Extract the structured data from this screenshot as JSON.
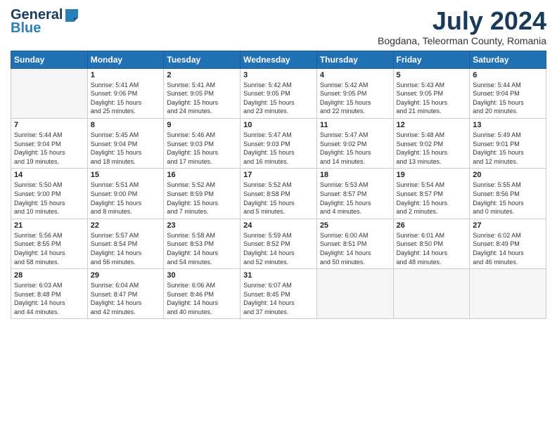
{
  "logo": {
    "line1": "General",
    "line2": "Blue"
  },
  "title": "July 2024",
  "location": "Bogdana, Teleorman County, Romania",
  "weekdays": [
    "Sunday",
    "Monday",
    "Tuesday",
    "Wednesday",
    "Thursday",
    "Friday",
    "Saturday"
  ],
  "weeks": [
    [
      {
        "day": "",
        "info": ""
      },
      {
        "day": "1",
        "info": "Sunrise: 5:41 AM\nSunset: 9:06 PM\nDaylight: 15 hours\nand 25 minutes."
      },
      {
        "day": "2",
        "info": "Sunrise: 5:41 AM\nSunset: 9:05 PM\nDaylight: 15 hours\nand 24 minutes."
      },
      {
        "day": "3",
        "info": "Sunrise: 5:42 AM\nSunset: 9:05 PM\nDaylight: 15 hours\nand 23 minutes."
      },
      {
        "day": "4",
        "info": "Sunrise: 5:42 AM\nSunset: 9:05 PM\nDaylight: 15 hours\nand 22 minutes."
      },
      {
        "day": "5",
        "info": "Sunrise: 5:43 AM\nSunset: 9:05 PM\nDaylight: 15 hours\nand 21 minutes."
      },
      {
        "day": "6",
        "info": "Sunrise: 5:44 AM\nSunset: 9:04 PM\nDaylight: 15 hours\nand 20 minutes."
      }
    ],
    [
      {
        "day": "7",
        "info": "Sunrise: 5:44 AM\nSunset: 9:04 PM\nDaylight: 15 hours\nand 19 minutes."
      },
      {
        "day": "8",
        "info": "Sunrise: 5:45 AM\nSunset: 9:04 PM\nDaylight: 15 hours\nand 18 minutes."
      },
      {
        "day": "9",
        "info": "Sunrise: 5:46 AM\nSunset: 9:03 PM\nDaylight: 15 hours\nand 17 minutes."
      },
      {
        "day": "10",
        "info": "Sunrise: 5:47 AM\nSunset: 9:03 PM\nDaylight: 15 hours\nand 16 minutes."
      },
      {
        "day": "11",
        "info": "Sunrise: 5:47 AM\nSunset: 9:02 PM\nDaylight: 15 hours\nand 14 minutes."
      },
      {
        "day": "12",
        "info": "Sunrise: 5:48 AM\nSunset: 9:02 PM\nDaylight: 15 hours\nand 13 minutes."
      },
      {
        "day": "13",
        "info": "Sunrise: 5:49 AM\nSunset: 9:01 PM\nDaylight: 15 hours\nand 12 minutes."
      }
    ],
    [
      {
        "day": "14",
        "info": "Sunrise: 5:50 AM\nSunset: 9:00 PM\nDaylight: 15 hours\nand 10 minutes."
      },
      {
        "day": "15",
        "info": "Sunrise: 5:51 AM\nSunset: 9:00 PM\nDaylight: 15 hours\nand 8 minutes."
      },
      {
        "day": "16",
        "info": "Sunrise: 5:52 AM\nSunset: 8:59 PM\nDaylight: 15 hours\nand 7 minutes."
      },
      {
        "day": "17",
        "info": "Sunrise: 5:52 AM\nSunset: 8:58 PM\nDaylight: 15 hours\nand 5 minutes."
      },
      {
        "day": "18",
        "info": "Sunrise: 5:53 AM\nSunset: 8:57 PM\nDaylight: 15 hours\nand 4 minutes."
      },
      {
        "day": "19",
        "info": "Sunrise: 5:54 AM\nSunset: 8:57 PM\nDaylight: 15 hours\nand 2 minutes."
      },
      {
        "day": "20",
        "info": "Sunrise: 5:55 AM\nSunset: 8:56 PM\nDaylight: 15 hours\nand 0 minutes."
      }
    ],
    [
      {
        "day": "21",
        "info": "Sunrise: 5:56 AM\nSunset: 8:55 PM\nDaylight: 14 hours\nand 58 minutes."
      },
      {
        "day": "22",
        "info": "Sunrise: 5:57 AM\nSunset: 8:54 PM\nDaylight: 14 hours\nand 56 minutes."
      },
      {
        "day": "23",
        "info": "Sunrise: 5:58 AM\nSunset: 8:53 PM\nDaylight: 14 hours\nand 54 minutes."
      },
      {
        "day": "24",
        "info": "Sunrise: 5:59 AM\nSunset: 8:52 PM\nDaylight: 14 hours\nand 52 minutes."
      },
      {
        "day": "25",
        "info": "Sunrise: 6:00 AM\nSunset: 8:51 PM\nDaylight: 14 hours\nand 50 minutes."
      },
      {
        "day": "26",
        "info": "Sunrise: 6:01 AM\nSunset: 8:50 PM\nDaylight: 14 hours\nand 48 minutes."
      },
      {
        "day": "27",
        "info": "Sunrise: 6:02 AM\nSunset: 8:49 PM\nDaylight: 14 hours\nand 46 minutes."
      }
    ],
    [
      {
        "day": "28",
        "info": "Sunrise: 6:03 AM\nSunset: 8:48 PM\nDaylight: 14 hours\nand 44 minutes."
      },
      {
        "day": "29",
        "info": "Sunrise: 6:04 AM\nSunset: 8:47 PM\nDaylight: 14 hours\nand 42 minutes."
      },
      {
        "day": "30",
        "info": "Sunrise: 6:06 AM\nSunset: 8:46 PM\nDaylight: 14 hours\nand 40 minutes."
      },
      {
        "day": "31",
        "info": "Sunrise: 6:07 AM\nSunset: 8:45 PM\nDaylight: 14 hours\nand 37 minutes."
      },
      {
        "day": "",
        "info": ""
      },
      {
        "day": "",
        "info": ""
      },
      {
        "day": "",
        "info": ""
      }
    ]
  ]
}
